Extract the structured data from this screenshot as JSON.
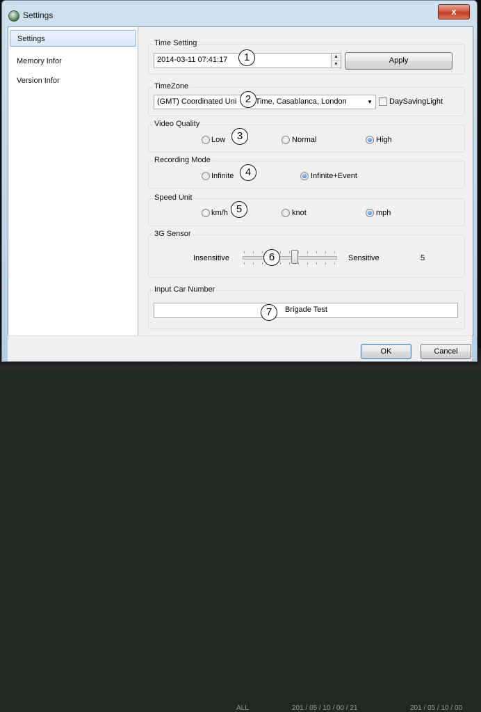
{
  "window": {
    "title": "Settings",
    "close_glyph": "x"
  },
  "sidebar": {
    "items": [
      {
        "label": "Settings",
        "selected": true
      },
      {
        "label": "Memory Infor",
        "selected": false
      },
      {
        "label": "Version Infor",
        "selected": false
      }
    ]
  },
  "time_setting": {
    "label": "Time Setting",
    "value": "2014-03-11 07:41:17",
    "apply_label": "Apply"
  },
  "timezone": {
    "label": "TimeZone",
    "value": "(GMT) Coordinated Uni",
    "value_tail": "l Time, Casablanca, London",
    "dst_label": "DaySavingLight",
    "dst_checked": false
  },
  "video_quality": {
    "label": "Video Quality",
    "options": [
      "Low",
      "Normal",
      "High"
    ],
    "selected": "High"
  },
  "recording_mode": {
    "label": "Recording Mode",
    "options": [
      "Infinite",
      "Infinite+Event"
    ],
    "selected": "Infinite+Event"
  },
  "speed_unit": {
    "label": "Speed Unit",
    "options": [
      "km/h",
      "knot",
      "mph"
    ],
    "selected": "mph"
  },
  "g_sensor": {
    "label": "3G Sensor",
    "min_label": "Insensitive",
    "max_label": "Sensitive",
    "value": "5"
  },
  "car_number": {
    "label": "Input Car Number",
    "value": "Brigade Test"
  },
  "footer": {
    "ok_label": "OK",
    "cancel_label": "Cancel"
  },
  "markers": [
    "1",
    "2",
    "3",
    "4",
    "5",
    "6",
    "7"
  ],
  "background": {
    "text_1": "ALL",
    "text_2": "201 / 05 / 10 / 00 / 21",
    "text_3": "201 / 05 / 10 / 00"
  },
  "colors": {
    "selected_radio": "#1c63b8",
    "close_button": "#c23d21",
    "sidebar_selection": "#d6e8fa"
  }
}
